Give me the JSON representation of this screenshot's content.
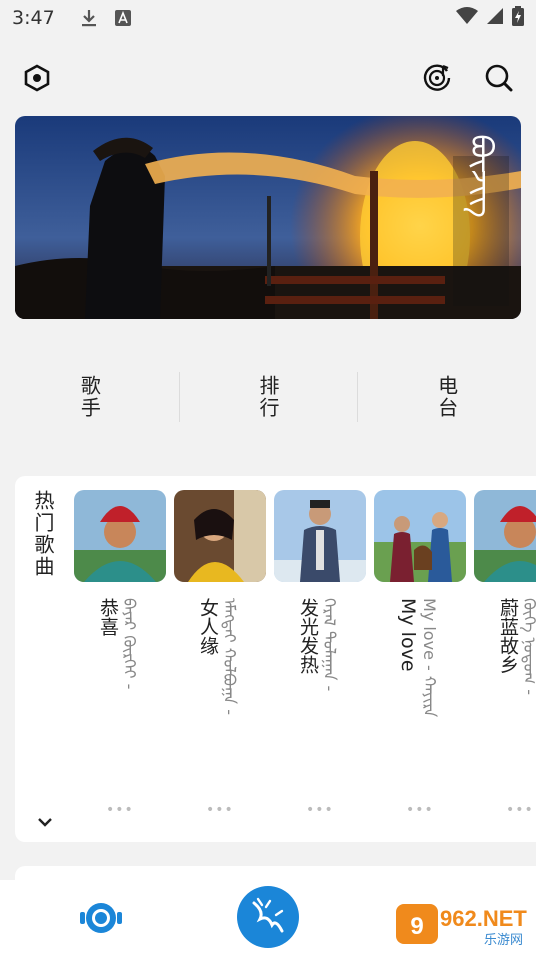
{
  "statusbar": {
    "time": "3:47"
  },
  "colors": {
    "accent": "#1b86d8",
    "background": "#f2f2f2",
    "card": "#ffffff"
  },
  "topbar": {
    "left_icon": "hexagon-settings-icon",
    "right_icons": [
      "music-disc-icon",
      "search-icon"
    ]
  },
  "banner": {
    "mongolian_caption": "ᠪᠦᠵᠢᠭ"
  },
  "quicknav": [
    {
      "label": "歌手"
    },
    {
      "label": "排行"
    },
    {
      "label": "电台"
    }
  ],
  "hot_songs": {
    "title": "热门歌曲",
    "items": [
      {
        "title": "恭喜",
        "artist": "ᠪᠠᠶᠠᠷ ᠬᠦᠷᠭᠡᠶ -",
        "more": "•••"
      },
      {
        "title": "女人缘",
        "artist": "ᠡᠮᠡᠭᠲᠡᠶ ᠬᠣᠯᠪᠣᠭᠠ -",
        "more": "•••"
      },
      {
        "title": "发光发热",
        "artist": "ᠭᠡᠷᠡᠯ ᠳᠤᠯᠠᠭᠠᠨ -",
        "more": "•••"
      },
      {
        "title": "My love",
        "artist": "My love - ᠬᠠᠶᠢᠷᠠ",
        "more": "•••"
      },
      {
        "title": "蔚蓝故乡",
        "artist": "ᠬᠥᠬᠡ ᠨᠤᠲᠤᠭ -",
        "more": "•••"
      }
    ]
  },
  "bottom_nav": [
    {
      "icon": "radio-target-icon"
    },
    {
      "icon": "center-logo-icon"
    }
  ],
  "watermark": {
    "text": "962.NET",
    "sub": "乐游网"
  }
}
